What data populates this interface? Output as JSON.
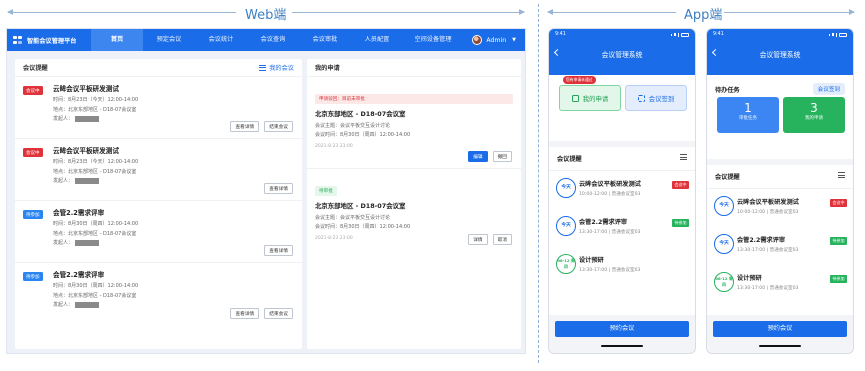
{
  "labels": {
    "web": "Web端",
    "app": "App端"
  },
  "web": {
    "app_title": "智能会议管理平台",
    "nav": [
      "首页",
      "预定会议",
      "会议统计",
      "会议查询",
      "会议审批",
      "人员配置",
      "空间设备管理"
    ],
    "user": "Admin",
    "left_panel": {
      "title": "会议提醒",
      "link": "我的会议",
      "items": [
        {
          "tag": "会议中",
          "tag_color": "#e0323a",
          "title": "云眸会议平板研发测试",
          "time": "时间：8月23日（今天）12:00-14:00",
          "place": "地点：北京东部地区 - D18-07会议室",
          "initiator": "发起人：",
          "buttons": [
            "查看详情",
            "结束会议"
          ]
        },
        {
          "tag": "会议中",
          "tag_color": "#e0323a",
          "title": "云眸会议平板研发测试",
          "time": "时间：8月23日（今天）12:00-14:00",
          "place": "地点：北京东部地区 - D18-07会议室",
          "initiator": "发起人：",
          "buttons": [
            "查看详情"
          ]
        },
        {
          "tag": "待参加",
          "tag_color": "#2a85f0",
          "title": "会管2.2需求评审",
          "time": "时间：8月30日（周四）12:00-14:00",
          "place": "地点：北京东部地区 - D18-07会议室",
          "initiator": "发起人：",
          "buttons": [
            "查看详情"
          ]
        },
        {
          "tag": "待参加",
          "tag_color": "#2a85f0",
          "title": "会管2.2需求评审",
          "time": "时间：8月30日（周四）12:00-14:00",
          "place": "地点：北京东部地区 - D18-07会议室",
          "initiator": "发起人：",
          "buttons": [
            "查看详情",
            "结束会议"
          ]
        }
      ]
    },
    "right_panel": {
      "title": "我的申请",
      "items": [
        {
          "status": "申请驳回：目前未审批",
          "title": "北京东部地区 - D18-07会议室",
          "subject": "会议主题：会议平板交互设计讨论",
          "time": "会议时间：8月30日（周四）12:00-14:00",
          "submitted": "2021-8-23 23:00",
          "buttons": [
            "编辑",
            "撤回"
          ]
        },
        {
          "status": "待审批",
          "title": "北京东部地区 - D18-07会议室",
          "subject": "会议主题：会议平板交互设计讨论",
          "time": "会议时间：8月30日（周四）12:00-14:00",
          "submitted": "2021-8-23 23:00",
          "buttons": [
            "详情",
            "取消"
          ]
        }
      ]
    }
  },
  "app1": {
    "clock": "9:41",
    "title": "会议管理系统",
    "quick": {
      "apply": "我的申请",
      "apply_badge": "您有申请未通过",
      "signin": "会议签到"
    },
    "reminder_title": "会议提醒",
    "items": [
      {
        "date": "今天",
        "title": "云眸会议平板研发测试",
        "sub": "10:00-12:00 | 普通会议室03",
        "tag": "会议中",
        "tag_color": "#e0323a"
      },
      {
        "date": "今天",
        "title": "会管2.2需求评审",
        "sub": "13:30-17:00 | 普通会议室03",
        "tag": "待参加",
        "tag_color": "#27b25d"
      },
      {
        "date": "08-12 周四",
        "title": "设计预研",
        "sub": "13:30-17:00 | 普通会议室03",
        "tag": "",
        "tag_color": ""
      }
    ],
    "book": "预约会议"
  },
  "app2": {
    "clock": "9:41",
    "title": "会议管理系统",
    "todo_title": "待办任务",
    "signin": "会议签到",
    "cards": [
      {
        "num": "1",
        "label": "审批任务"
      },
      {
        "num": "3",
        "label": "我的申请"
      }
    ],
    "reminder_title": "会议提醒",
    "items": [
      {
        "date": "今天",
        "title": "云眸会议平板研发测试",
        "sub": "10:00-12:00 | 普通会议室03",
        "tag": "会议中",
        "tag_color": "#e0323a"
      },
      {
        "date": "今天",
        "title": "会管2.2需求评审",
        "sub": "13:30-17:00 | 普通会议室03",
        "tag": "待参加",
        "tag_color": "#27b25d"
      },
      {
        "date": "08-12 周四",
        "title": "设计预研",
        "sub": "13:30-17:00 | 普通会议室03",
        "tag": "待参加",
        "tag_color": "#27b25d"
      }
    ],
    "book": "预约会议"
  }
}
